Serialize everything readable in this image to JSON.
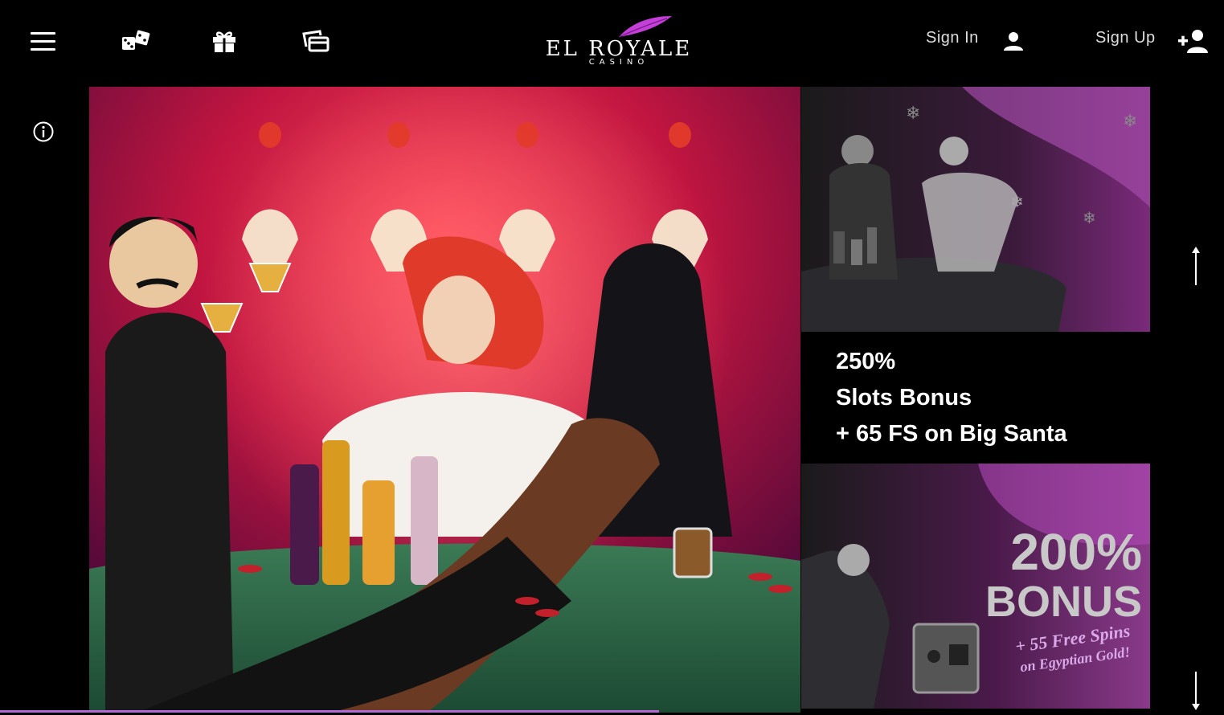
{
  "header": {
    "logo_main": "EL ROYALE",
    "logo_sub": "CASINO",
    "sign_in_label": "Sign In",
    "sign_up_label": "Sign Up"
  },
  "icons": {
    "menu": "hamburger-icon",
    "games": "dice-icon",
    "promotions": "gift-icon",
    "cards": "cards-icon",
    "user": "user-icon",
    "add_user": "add-user-icon",
    "info": "info-icon",
    "scroll_up": "arrow-up-icon",
    "scroll_down": "arrow-down-icon"
  },
  "promos": [
    {
      "lines": [
        "250%",
        "Slots Bonus",
        "+ 65 FS on Big Santa"
      ]
    },
    {
      "art_headline": "200%",
      "art_subheadline": "BONUS",
      "art_tagline_1": "+ 55 Free Spins",
      "art_tagline_2": "on Egyptian Gold!"
    }
  ],
  "colors": {
    "background": "#000000",
    "accent": "#b36ad6",
    "logo_feather": "#c43fd8"
  }
}
